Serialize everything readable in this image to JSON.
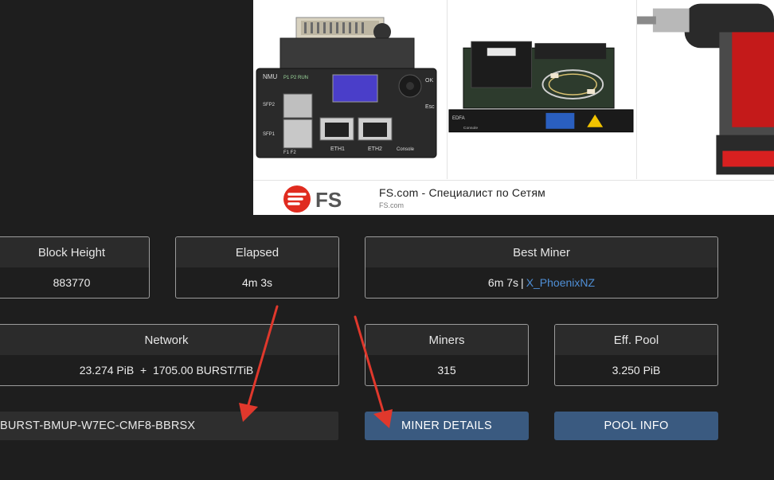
{
  "ad": {
    "title": "FS.com - Специалист по Сетям",
    "url": "FS.com",
    "logo_text": "FS",
    "product1_labels": {
      "brand": "NMU",
      "leds": "P1 P2 RUN",
      "ok": "OK",
      "esc": "Esc",
      "sfp2": "SFP2",
      "sfp1": "SFP1",
      "f1f2": "F1 F2",
      "eth1": "ETH1",
      "eth2": "ETH2",
      "console": "Console"
    },
    "product2_labels": {
      "brand": "EDFA",
      "console": "Console"
    }
  },
  "stats": {
    "block_height": {
      "label": "Block Height",
      "value": "883770"
    },
    "elapsed": {
      "label": "Elapsed",
      "value": "4m 3s"
    },
    "best_miner": {
      "label": "Best Miner",
      "time": "6m 7s",
      "separator": "|",
      "miner": "X_PhoenixNZ"
    },
    "network": {
      "label": "Network",
      "value": "23.274 PiB  +  1705.00 BURST/TiB"
    },
    "miners": {
      "label": "Miners",
      "value": "315"
    },
    "eff_pool": {
      "label": "Eff. Pool",
      "value": "3.250 PiB"
    }
  },
  "account": {
    "address": "BURST-BMUP-W7EC-CMF8-BBRSX"
  },
  "buttons": {
    "miner_details": "MINER DETAILS",
    "pool_info": "POOL INFO"
  },
  "colors": {
    "background": "#1e1e1e",
    "card_header": "#2b2b2b",
    "card_border": "#9c9c9c",
    "button": "#3a5a80",
    "link": "#4f8fd6",
    "annotation_arrow": "#e0382c",
    "fs_logo_red": "#e02b1f"
  }
}
